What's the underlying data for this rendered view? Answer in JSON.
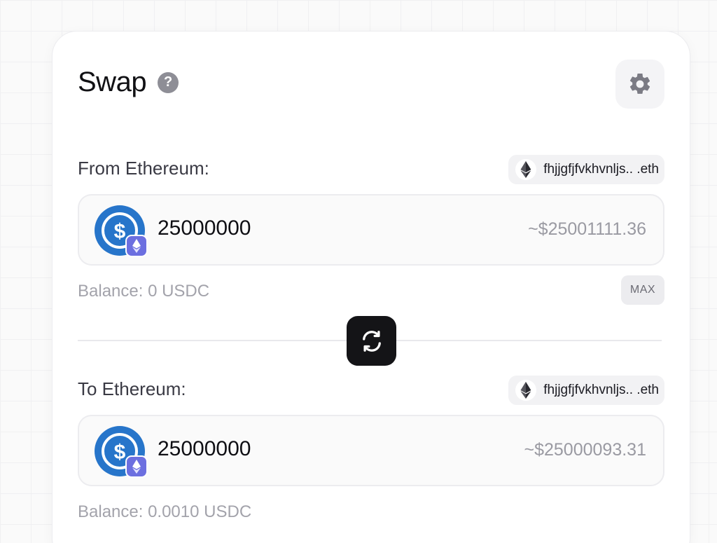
{
  "header": {
    "title": "Swap",
    "help_glyph": "?",
    "help_icon": "question-circle-icon",
    "settings_icon": "gear-icon"
  },
  "from": {
    "label": "From Ethereum:",
    "wallet": "fhjjgfjfvkhvnljs.. .eth",
    "amount": "25000000",
    "usd": "~$25001111.36",
    "balance": "Balance: 0 USDC",
    "max_label": "MAX",
    "token_icon": "usdc-icon",
    "network_badge": "ethereum-icon"
  },
  "to": {
    "label": "To Ethereum:",
    "wallet": "fhjjgfjfvkhvnljs.. .eth",
    "amount": "25000000",
    "usd": "~$25000093.31",
    "balance": "Balance: 0.0010 USDC",
    "token_icon": "usdc-icon",
    "network_badge": "ethereum-icon"
  },
  "swap_direction_icon": "swap-arrows-icon",
  "colors": {
    "usdc_blue": "#2775CA",
    "eth_badge": "#6c6fe0",
    "swap_button": "#141417"
  }
}
